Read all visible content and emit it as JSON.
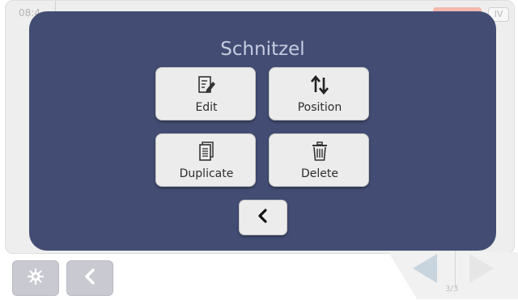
{
  "status_bar": {
    "time": "08:4",
    "badge": "IV"
  },
  "dialog": {
    "title": "Schnitzel",
    "actions": [
      {
        "label": "Edit",
        "icon": "edit-icon"
      },
      {
        "label": "Position",
        "icon": "position-arrows-icon"
      },
      {
        "label": "Duplicate",
        "icon": "duplicate-icon"
      },
      {
        "label": "Delete",
        "icon": "trash-icon"
      }
    ],
    "back_icon": "chevron-left-icon"
  },
  "bottom_bar": {
    "settings_icon": "gear-icon",
    "back_icon": "chevron-left-icon"
  },
  "pager": {
    "label": "3/3",
    "prev_icon": "triangle-left-icon",
    "next_icon": "triangle-right-icon"
  },
  "colors": {
    "modal_bg": "#434d73",
    "modal_title": "#c6ccdf",
    "button_bg": "#ececec",
    "alert_indicator": "#f2b9ac"
  }
}
